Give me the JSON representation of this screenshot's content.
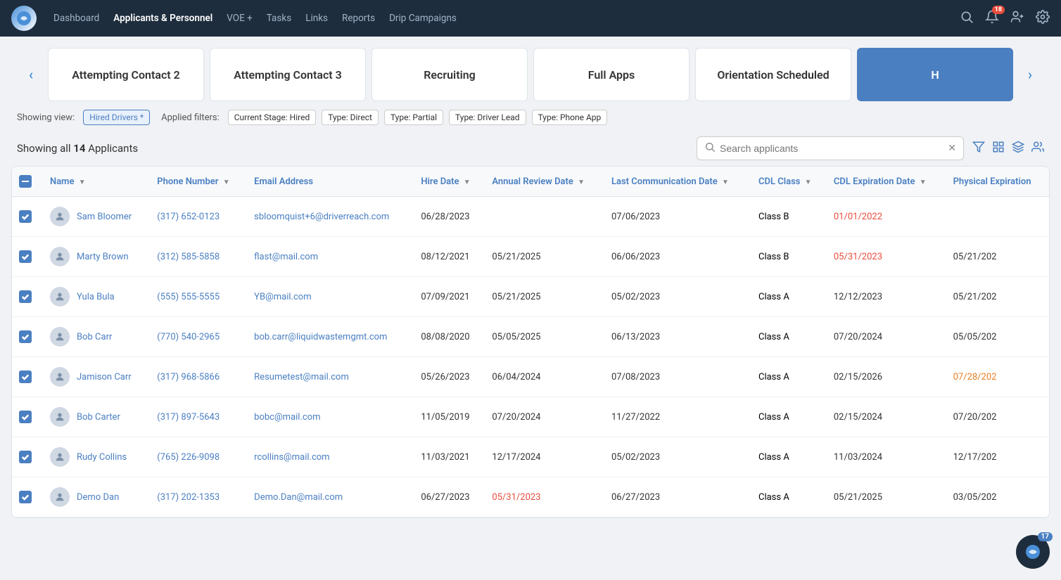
{
  "nav": {
    "logo": "DR",
    "links": [
      {
        "label": "Dashboard",
        "active": false
      },
      {
        "label": "Applicants & Personnel",
        "active": true
      },
      {
        "label": "VOE +",
        "active": false
      },
      {
        "label": "Tasks",
        "active": false
      },
      {
        "label": "Links",
        "active": false
      },
      {
        "label": "Reports",
        "active": false
      },
      {
        "label": "Drip Campaigns",
        "active": false
      }
    ],
    "notification_count": "18"
  },
  "stage_tabs": [
    {
      "label": "Attempting Contact 2",
      "active": false
    },
    {
      "label": "Attempting Contact 3",
      "active": false
    },
    {
      "label": "Recruiting",
      "active": false
    },
    {
      "label": "Full Apps",
      "active": false
    },
    {
      "label": "Orientation Scheduled",
      "active": false
    },
    {
      "label": "H",
      "active": true
    }
  ],
  "filters": {
    "showing_view_label": "Showing view:",
    "active_view": "Hired Drivers *",
    "applied_label": "Applied filters:",
    "chips": [
      {
        "label": "Current Stage: Hired"
      },
      {
        "label": "Type: Direct"
      },
      {
        "label": "Type: Partial"
      },
      {
        "label": "Type: Driver Lead"
      },
      {
        "label": "Type: Phone App"
      }
    ]
  },
  "table": {
    "showing_text": "Showing all",
    "count": "14",
    "applicants_label": "Applicants",
    "search_placeholder": "Search applicants",
    "columns": [
      {
        "label": "Name"
      },
      {
        "label": "Phone Number"
      },
      {
        "label": "Email Address"
      },
      {
        "label": "Hire Date"
      },
      {
        "label": "Annual Review Date"
      },
      {
        "label": "Last Communication Date"
      },
      {
        "label": "CDL Class"
      },
      {
        "label": "CDL Expiration Date"
      },
      {
        "label": "Physical Expiration"
      }
    ],
    "rows": [
      {
        "name": "Sam Bloomer",
        "phone": "(317) 652-0123",
        "email": "sbloomquist+6@driverreach.com",
        "hire_date": "06/28/2023",
        "annual_review": "",
        "last_comm": "07/06/2023",
        "cdl_class": "Class B",
        "cdl_exp": "01/01/2022",
        "cdl_exp_color": "red",
        "physical_exp": "",
        "physical_exp_color": "normal"
      },
      {
        "name": "Marty Brown",
        "phone": "(312) 585-5858",
        "email": "flast@mail.com",
        "hire_date": "08/12/2021",
        "annual_review": "05/21/2025",
        "last_comm": "06/06/2023",
        "cdl_class": "Class B",
        "cdl_exp": "05/31/2023",
        "cdl_exp_color": "red",
        "physical_exp": "05/21/202",
        "physical_exp_color": "normal"
      },
      {
        "name": "Yula Bula",
        "phone": "(555) 555-5555",
        "email": "YB@mail.com",
        "hire_date": "07/09/2021",
        "annual_review": "05/21/2025",
        "last_comm": "05/02/2023",
        "cdl_class": "Class A",
        "cdl_exp": "12/12/2023",
        "cdl_exp_color": "normal",
        "physical_exp": "05/21/202",
        "physical_exp_color": "normal"
      },
      {
        "name": "Bob Carr",
        "phone": "(770) 540-2965",
        "email": "bob.carr@liquidwastemgmt.com",
        "hire_date": "08/08/2020",
        "annual_review": "05/05/2025",
        "last_comm": "06/13/2023",
        "cdl_class": "Class A",
        "cdl_exp": "07/20/2024",
        "cdl_exp_color": "normal",
        "physical_exp": "05/05/202",
        "physical_exp_color": "normal"
      },
      {
        "name": "Jamison Carr",
        "phone": "(317) 968-5866",
        "email": "Resumetest@mail.com",
        "hire_date": "05/26/2023",
        "annual_review": "06/04/2024",
        "last_comm": "07/08/2023",
        "cdl_class": "Class A",
        "cdl_exp": "02/15/2026",
        "cdl_exp_color": "normal",
        "physical_exp": "07/28/202",
        "physical_exp_color": "orange"
      },
      {
        "name": "Bob Carter",
        "phone": "(317) 897-5643",
        "email": "bobc@mail.com",
        "hire_date": "11/05/2019",
        "annual_review": "07/20/2024",
        "last_comm": "11/27/2022",
        "cdl_class": "Class A",
        "cdl_exp": "02/15/2024",
        "cdl_exp_color": "normal",
        "physical_exp": "07/20/202",
        "physical_exp_color": "normal"
      },
      {
        "name": "Rudy Collins",
        "phone": "(765) 226-9098",
        "email": "rcollins@mail.com",
        "hire_date": "11/03/2021",
        "annual_review": "12/17/2024",
        "last_comm": "05/02/2023",
        "cdl_class": "Class A",
        "cdl_exp": "11/03/2024",
        "cdl_exp_color": "normal",
        "physical_exp": "12/17/202",
        "physical_exp_color": "normal"
      },
      {
        "name": "Demo Dan",
        "phone": "(317) 202-1353",
        "email": "Demo.Dan@mail.com",
        "hire_date": "06/27/2023",
        "annual_review": "05/31/2023",
        "annual_review_color": "red",
        "last_comm": "06/27/2023",
        "cdl_class": "Class A",
        "cdl_exp": "05/21/2025",
        "cdl_exp_color": "normal",
        "physical_exp": "03/05/202",
        "physical_exp_color": "normal"
      }
    ]
  },
  "floating": {
    "count": "17",
    "logo": "DR"
  }
}
